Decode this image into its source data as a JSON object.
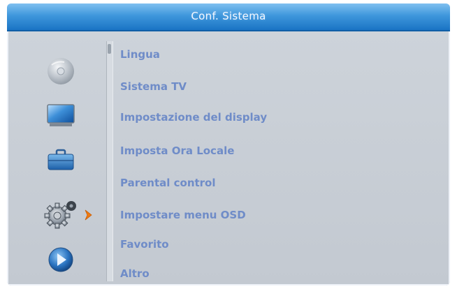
{
  "window": {
    "title": "Conf. Sistema"
  },
  "sidebar": {
    "icons": [
      {
        "name": "disc-icon"
      },
      {
        "name": "tv-screen-icon"
      },
      {
        "name": "briefcase-icon"
      },
      {
        "name": "gear-settings-icon",
        "selected": true
      },
      {
        "name": "play-icon"
      }
    ]
  },
  "menu": {
    "items": [
      {
        "label": "Lingua"
      },
      {
        "label": "Sistema TV"
      },
      {
        "label": "Impostazione del display"
      },
      {
        "label": "Imposta Ora Locale"
      },
      {
        "label": "Parental control"
      },
      {
        "label": "Impostare menu OSD"
      },
      {
        "label": "Favorito"
      },
      {
        "label": "Altro"
      }
    ]
  },
  "colors": {
    "title_bar": "#2a86d2",
    "background": "#c6ccd4",
    "menu_text": "#6f8cc8",
    "selection_arrow": "#f07a12"
  }
}
